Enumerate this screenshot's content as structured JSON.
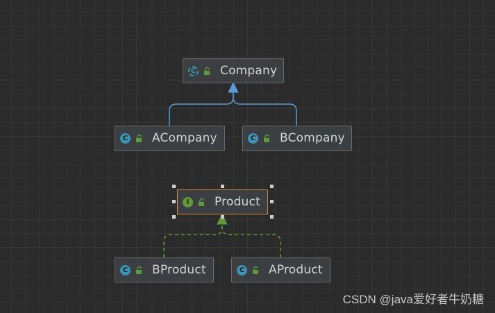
{
  "nodes": {
    "company": {
      "label": "Company",
      "kind": "abstract-class",
      "icon": "abstract-class-icon"
    },
    "acompany": {
      "label": "ACompany",
      "kind": "class",
      "icon": "class-icon"
    },
    "bcompany": {
      "label": "BCompany",
      "kind": "class",
      "icon": "class-icon"
    },
    "product": {
      "label": "Product",
      "kind": "interface",
      "icon": "interface-icon",
      "selected": true
    },
    "bproduct": {
      "label": "BProduct",
      "kind": "class",
      "icon": "class-icon"
    },
    "aproduct": {
      "label": "AProduct",
      "kind": "class",
      "icon": "class-icon"
    }
  },
  "edges": [
    {
      "from": "ACompany",
      "to": "Company",
      "type": "extends"
    },
    {
      "from": "BCompany",
      "to": "Company",
      "type": "extends"
    },
    {
      "from": "BProduct",
      "to": "Product",
      "type": "implements"
    },
    {
      "from": "AProduct",
      "to": "Product",
      "type": "implements"
    }
  ],
  "icons": {
    "class_letter": "C",
    "interface_letter": "I"
  },
  "colors": {
    "background": "#2b2b2b",
    "node_fill": "#3c3f41",
    "extends_arrow": "#5a9bd8",
    "implements_arrow": "#5d9b3a",
    "selection_border": "#d08a3e"
  },
  "watermark": "CSDN @java爱好者牛奶糖"
}
